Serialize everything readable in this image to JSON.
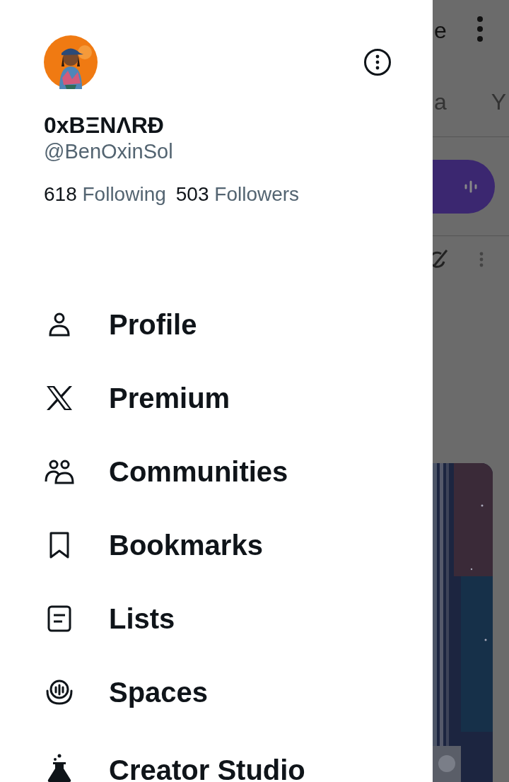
{
  "background": {
    "header_fragment": "e",
    "tabs": [
      "a",
      "Y"
    ]
  },
  "drawer": {
    "name": "0xBΞNΛRĐ",
    "handle": "@BenOxinSol",
    "stats": [
      {
        "count": "618",
        "label": "Following"
      },
      {
        "count": "503",
        "label": "Followers"
      }
    ],
    "menu": [
      {
        "kind": "profile",
        "label": "Profile"
      },
      {
        "kind": "premium",
        "label": "Premium"
      },
      {
        "kind": "communities",
        "label": "Communities"
      },
      {
        "kind": "bookmarks",
        "label": "Bookmarks"
      },
      {
        "kind": "lists",
        "label": "Lists"
      },
      {
        "kind": "spaces",
        "label": "Spaces"
      },
      {
        "kind": "creator",
        "label": "Creator Studio"
      }
    ]
  }
}
